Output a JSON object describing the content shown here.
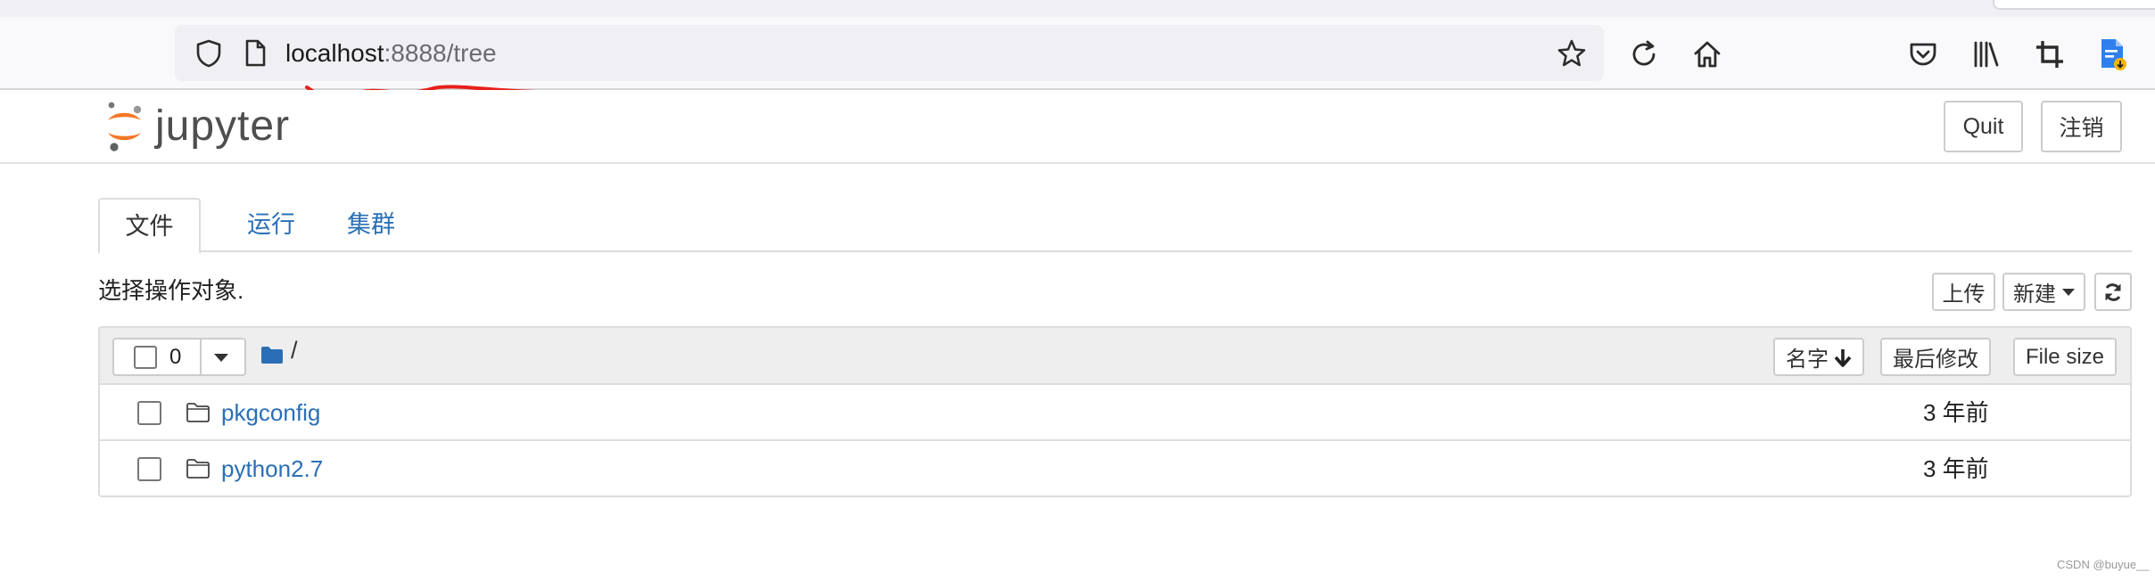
{
  "browser": {
    "url_host": "localhost",
    "url_rest": ":8888/tree",
    "icons": [
      "shield-icon",
      "page-icon",
      "bookmark-star-icon",
      "reload-icon",
      "home-icon",
      "pocket-icon",
      "library-icon",
      "screenshot-crop-icon",
      "extension-icon"
    ]
  },
  "header": {
    "logo_text": "jupyter",
    "quit_label": "Quit",
    "logout_label": "注销"
  },
  "tabs": [
    {
      "label": "文件",
      "active": true
    },
    {
      "label": "运行",
      "active": false
    },
    {
      "label": "集群",
      "active": false
    }
  ],
  "toolbar": {
    "select_hint": "选择操作对象.",
    "upload_label": "上传",
    "new_label": "新建",
    "refresh_icon": "refresh-icon"
  },
  "file_list": {
    "selected_count": "0",
    "path": "/",
    "columns": {
      "name": "名字",
      "last_modified": "最后修改",
      "file_size": "File size"
    },
    "items": [
      {
        "name": "pkgconfig",
        "modified": "3 年前",
        "type": "folder"
      },
      {
        "name": "python2.7",
        "modified": "3 年前",
        "type": "folder"
      }
    ]
  },
  "colors": {
    "link": "#2a6fb5",
    "logo_orange": "#f37726",
    "annotation_red": "#e8201a"
  },
  "watermark": "CSDN @buyue__"
}
